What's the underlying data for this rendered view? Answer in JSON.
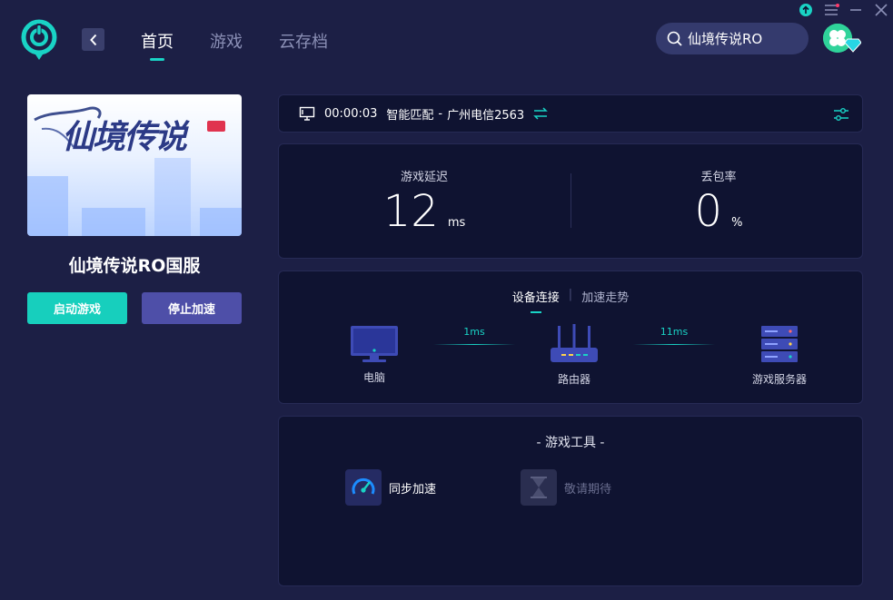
{
  "nav": {
    "tabs": [
      {
        "label": "首页",
        "active": true
      },
      {
        "label": "游戏",
        "active": false
      },
      {
        "label": "云存档",
        "active": false
      }
    ]
  },
  "search": {
    "value": "仙境传说RO"
  },
  "icons": {
    "logo": "power-ring-logo",
    "back": "chevron-left-icon",
    "upgrade": "arrow-up-circle-icon",
    "menu": "menu-icon",
    "minimize": "minimize-icon",
    "close": "close-icon",
    "search": "search-icon",
    "monitor": "monitor-icon",
    "switch": "swap-icon",
    "settings": "sliders-icon"
  },
  "game": {
    "cover_title": "仙境传说",
    "name": "仙境传说RO国服",
    "start_label": "启动游戏",
    "stop_label": "停止加速"
  },
  "status": {
    "timer": "00:00:03",
    "mode": "智能匹配",
    "separator": "-",
    "server": "广州电信2563"
  },
  "metrics": {
    "latency_label": "游戏延迟",
    "latency_value": "12",
    "latency_unit": "ms",
    "loss_label": "丢包率",
    "loss_value": "0",
    "loss_unit": "%"
  },
  "device_panel": {
    "tabs": [
      {
        "label": "设备连接",
        "active": true
      },
      {
        "label": "加速走势",
        "active": false
      }
    ],
    "devices": [
      {
        "label": "电脑"
      },
      {
        "label": "路由器"
      },
      {
        "label": "游戏服务器"
      }
    ],
    "links": [
      {
        "label": "1ms"
      },
      {
        "label": "11ms"
      }
    ]
  },
  "tools": {
    "title": "- 游戏工具 -",
    "items": [
      {
        "label": "同步加速",
        "enabled": true
      },
      {
        "label": "敬请期待",
        "enabled": false
      }
    ]
  },
  "colors": {
    "accent": "#19d3c5",
    "background": "#1c1f45",
    "card": "#0f1331",
    "stop_button": "#4e4fa8"
  }
}
